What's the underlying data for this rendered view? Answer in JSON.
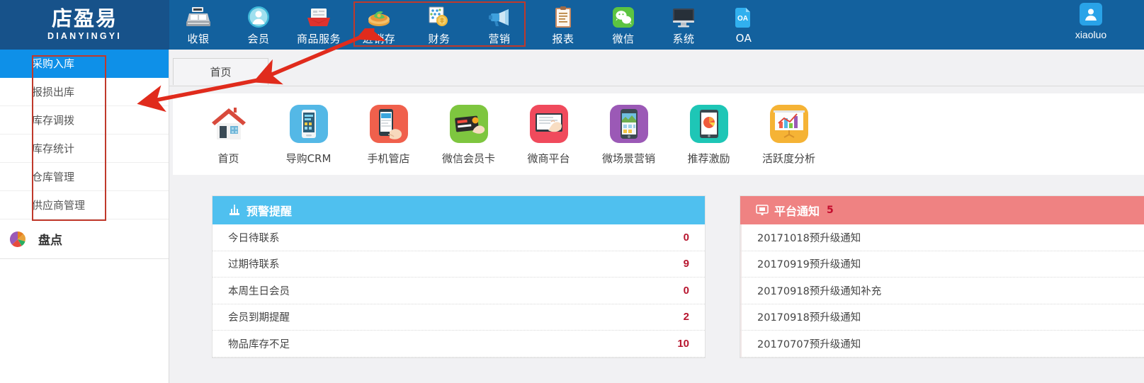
{
  "brand": {
    "logo_cn": "店盈易",
    "logo_en": "DIANYINGYI"
  },
  "topnav": {
    "items": [
      {
        "label": "收银",
        "icon": "cash-register-icon"
      },
      {
        "label": "会员",
        "icon": "member-avatar-icon"
      },
      {
        "label": "商品服务",
        "icon": "product-box-icon"
      },
      {
        "label": "进销存",
        "icon": "inventory-icon"
      },
      {
        "label": "财务",
        "icon": "finance-coins-icon"
      },
      {
        "label": "营销",
        "icon": "megaphone-icon"
      },
      {
        "label": "报表",
        "icon": "clipboard-report-icon"
      },
      {
        "label": "微信",
        "icon": "wechat-icon"
      },
      {
        "label": "系统",
        "icon": "monitor-system-icon"
      },
      {
        "label": "OA",
        "icon": "oa-document-icon"
      }
    ],
    "user": {
      "name": "xiaoluo",
      "icon": "user-avatar-icon"
    }
  },
  "sidebar": {
    "items": [
      {
        "label": "采购入库",
        "active": true
      },
      {
        "label": "报损出库",
        "active": false
      },
      {
        "label": "库存调拨",
        "active": false
      },
      {
        "label": "库存统计",
        "active": false
      },
      {
        "label": "仓库管理",
        "active": false
      },
      {
        "label": "供应商管理",
        "active": false
      }
    ],
    "group": {
      "label": "盘点",
      "icon": "pie-chart-icon"
    }
  },
  "tabs": [
    {
      "label": "首页",
      "active": true
    }
  ],
  "shortcuts": [
    {
      "label": "首页",
      "icon": "home-icon"
    },
    {
      "label": "导购CRM",
      "icon": "crm-phone-icon"
    },
    {
      "label": "手机管店",
      "icon": "mobile-shop-icon"
    },
    {
      "label": "微信会员卡",
      "icon": "membership-card-icon"
    },
    {
      "label": "微商平台",
      "icon": "wechat-business-icon"
    },
    {
      "label": "微场景营销",
      "icon": "scene-marketing-icon"
    },
    {
      "label": "推荐激励",
      "icon": "referral-reward-icon"
    },
    {
      "label": "活跃度分析",
      "icon": "activity-analysis-icon"
    }
  ],
  "warning_panel": {
    "title": "预警提醒",
    "icon": "alert-icon",
    "rows": [
      {
        "label": "今日待联系",
        "value": "0"
      },
      {
        "label": "过期待联系",
        "value": "9"
      },
      {
        "label": "本周生日会员",
        "value": "0"
      },
      {
        "label": "会员到期提醒",
        "value": "2"
      },
      {
        "label": "物品库存不足",
        "value": "10"
      }
    ]
  },
  "notice_panel": {
    "title": "平台通知",
    "icon": "monitor-notice-icon",
    "count": "5",
    "items": [
      {
        "label": "20171018预升级通知"
      },
      {
        "label": "20170919预升级通知"
      },
      {
        "label": "20170918预升级通知补充"
      },
      {
        "label": "20170918预升级通知"
      },
      {
        "label": "20170707预升级通知"
      }
    ]
  },
  "colors": {
    "topbar": "#13619e",
    "logo_bg": "#17528a",
    "sidebar_active": "#0e90e8",
    "warning_header": "#4fc0ef",
    "notice_header": "#ef8282",
    "value_red": "#b7152e",
    "annotation_red": "#c0392b",
    "content_bg": "#f1f1f3"
  }
}
